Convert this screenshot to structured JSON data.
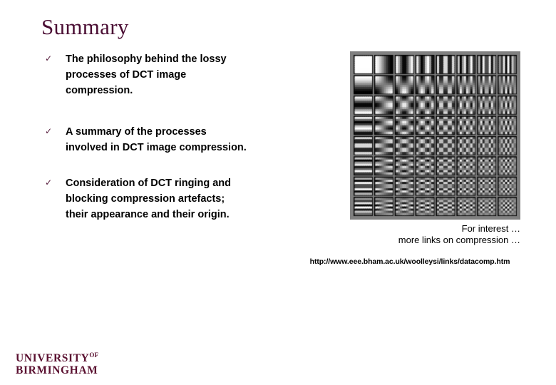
{
  "slide": {
    "title": "Summary",
    "title_color": "#4a0d33",
    "background_color": "#ffffff"
  },
  "bullets": {
    "marker_glyph": "✓",
    "marker_color": "#541a3a",
    "items": [
      {
        "text": "The philosophy behind the lossy\nprocesses of DCT image\ncompression."
      },
      {
        "text": "A summary of the processes\ninvolved in DCT image compression."
      },
      {
        "text": "Consideration of DCT ringing and\nblocking compression artefacts;\ntheir appearance and their origin."
      }
    ]
  },
  "figure": {
    "name": "dct-basis-functions-grid",
    "rows": 8,
    "cols": 8,
    "frame_color": "#808080",
    "cell_border_color": "#000000",
    "caption_lines": [
      "For interest …",
      "more links on compression …"
    ]
  },
  "link": {
    "url": "http://www.eee.bham.ac.uk/woolleysi/links/datacomp.htm"
  },
  "logo": {
    "line1": "UNIVERSITY",
    "superscript": "OF",
    "line2": "BIRMINGHAM",
    "color": "#5a1030"
  }
}
